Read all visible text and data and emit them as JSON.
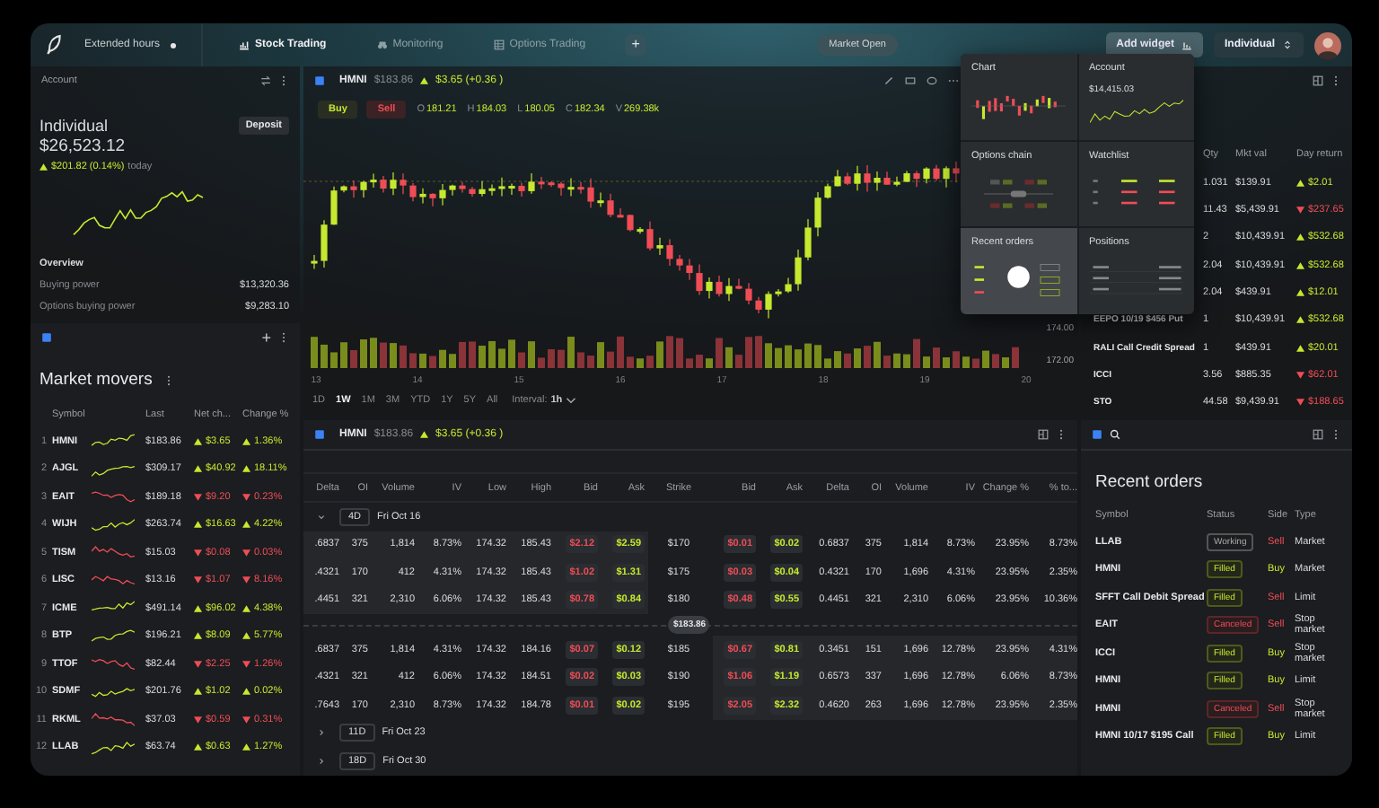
{
  "top_bar": {
    "extended_hours": "Extended hours",
    "tabs": [
      {
        "label": "Stock Trading",
        "kind": "chart",
        "selected": true
      },
      {
        "label": "Monitoring",
        "kind": "binoculars",
        "selected": false
      },
      {
        "label": "Options Trading",
        "kind": "table",
        "selected": false
      }
    ],
    "add_tab": "+",
    "market_status": "Market Open",
    "add_widget": "Add widget",
    "account_selector": "Individual"
  },
  "account": {
    "title": "Account",
    "name": "Individual",
    "deposit": "Deposit",
    "balance": "$26,523.12",
    "up": true,
    "change": "$201.82 (0.14%)",
    "period": "today",
    "overview_title": "Overview",
    "overview": [
      {
        "label": "Buying power",
        "value": "$13,320.36"
      },
      {
        "label": "Options buying power",
        "value": "$9,283.10"
      }
    ]
  },
  "market_movers": {
    "title": "Market movers",
    "add": "+",
    "columns": [
      "Symbol",
      "Last",
      "Net ch...",
      "Change %"
    ],
    "rows": [
      {
        "rank": "1",
        "symbol": "HMNI",
        "last": "$183.86",
        "net_change": "$3.65",
        "change_pct": "1.36%",
        "up": true
      },
      {
        "rank": "2",
        "symbol": "AJGL",
        "last": "$309.17",
        "net_change": "$40.92",
        "change_pct": "18.11%",
        "up": true
      },
      {
        "rank": "3",
        "symbol": "EAIT",
        "last": "$189.18",
        "net_change": "$9.20",
        "change_pct": "0.23%",
        "up": false
      },
      {
        "rank": "4",
        "symbol": "WIJH",
        "last": "$263.74",
        "net_change": "$16.63",
        "change_pct": "4.22%",
        "up": true
      },
      {
        "rank": "5",
        "symbol": "TISM",
        "last": "$15.03",
        "net_change": "$0.08",
        "change_pct": "0.03%",
        "up": false
      },
      {
        "rank": "6",
        "symbol": "LISC",
        "last": "$13.16",
        "net_change": "$1.07",
        "change_pct": "8.16%",
        "up": false
      },
      {
        "rank": "7",
        "symbol": "ICME",
        "last": "$491.14",
        "net_change": "$96.02",
        "change_pct": "4.38%",
        "up": true
      },
      {
        "rank": "8",
        "symbol": "BTP",
        "last": "$196.21",
        "net_change": "$8.09",
        "change_pct": "5.77%",
        "up": true
      },
      {
        "rank": "9",
        "symbol": "TTOF",
        "last": "$82.44",
        "net_change": "$2.25",
        "change_pct": "1.26%",
        "up": false
      },
      {
        "rank": "10",
        "symbol": "SDMF",
        "last": "$201.76",
        "net_change": "$1.02",
        "change_pct": "0.02%",
        "up": true
      },
      {
        "rank": "11",
        "symbol": "RKML",
        "last": "$37.03",
        "net_change": "$0.59",
        "change_pct": "0.31%",
        "up": false
      },
      {
        "rank": "12",
        "symbol": "LLAB",
        "last": "$63.74",
        "net_change": "$0.63",
        "change_pct": "1.27%",
        "up": true
      }
    ]
  },
  "chart": {
    "symbol": "HMNI",
    "price": "$183.86",
    "up": true,
    "change": "$3.65 (+0.36 )",
    "buy": "Buy",
    "sell": "Sell",
    "ohlcv": [
      {
        "label": "O",
        "value": "181.21"
      },
      {
        "label": "H",
        "value": "184.03"
      },
      {
        "label": "L",
        "value": "180.05"
      },
      {
        "label": "C",
        "value": "182.34"
      },
      {
        "label": "V",
        "value": "269.38k"
      }
    ],
    "price_labels": [
      "174.00",
      "172.00"
    ],
    "x_labels": [
      "13",
      "14",
      "15",
      "16",
      "17",
      "18",
      "19",
      "20"
    ],
    "ranges": [
      {
        "label": "1D",
        "selected": false
      },
      {
        "label": "1W",
        "selected": true
      },
      {
        "label": "1M",
        "selected": false
      },
      {
        "label": "3M",
        "selected": false
      },
      {
        "label": "YTD",
        "selected": false
      },
      {
        "label": "1Y",
        "selected": false
      },
      {
        "label": "5Y",
        "selected": false
      },
      {
        "label": "All",
        "selected": false
      }
    ],
    "interval_label": "Interval:",
    "interval": "1h"
  },
  "options_chain": {
    "symbol": "HMNI",
    "price": "$183.86",
    "up": true,
    "change": "$3.65 (+0.36 )",
    "call_columns": [
      "Delta",
      "OI",
      "Volume",
      "IV",
      "Low",
      "High",
      "Bid",
      "Ask"
    ],
    "strike_column": "Strike",
    "put_columns": [
      "Bid",
      "Ask",
      "Delta",
      "OI",
      "Volume",
      "IV",
      "Change %",
      "% to..."
    ],
    "expirations": [
      {
        "days": "4D",
        "date": "Fri Oct 16",
        "expanded": true,
        "rows": [
          {
            "kind": "strike",
            "calls": [
              ".6837",
              "375",
              "1,814",
              "8.73%",
              "174.32",
              "185.43",
              "$2.12",
              "$2.59"
            ],
            "calls_itm": true,
            "strike": "$170",
            "puts": [
              "$0.01",
              "$0.02",
              "0.6837",
              "375",
              "1,814",
              "8.73%",
              "23.95%",
              "8.73%"
            ],
            "puts_itm": false
          },
          {
            "kind": "strike",
            "calls": [
              ".4321",
              "170",
              "412",
              "4.31%",
              "174.32",
              "185.43",
              "$1.02",
              "$1.31"
            ],
            "calls_itm": true,
            "strike": "$175",
            "puts": [
              "$0.03",
              "$0.04",
              "0.4321",
              "170",
              "1,696",
              "4.31%",
              "23.95%",
              "2.35%"
            ],
            "puts_itm": false
          },
          {
            "kind": "strike",
            "calls": [
              ".4451",
              "321",
              "2,310",
              "6.06%",
              "174.32",
              "185.43",
              "$0.78",
              "$0.84"
            ],
            "calls_itm": true,
            "strike": "$180",
            "puts": [
              "$0.48",
              "$0.55",
              "0.4451",
              "321",
              "2,310",
              "6.06%",
              "23.95%",
              "10.36%"
            ],
            "puts_itm": false
          },
          {
            "kind": "marker",
            "price": "$183.86"
          },
          {
            "kind": "strike",
            "calls": [
              ".6837",
              "375",
              "1,814",
              "4.31%",
              "174.32",
              "184.16",
              "$0.07",
              "$0.12"
            ],
            "calls_itm": false,
            "strike": "$185",
            "puts": [
              "$0.67",
              "$0.81",
              "0.3451",
              "151",
              "1,696",
              "12.78%",
              "23.95%",
              "4.31%"
            ],
            "puts_itm": true
          },
          {
            "kind": "strike",
            "calls": [
              ".4321",
              "321",
              "412",
              "6.06%",
              "174.32",
              "184.51",
              "$0.02",
              "$0.03"
            ],
            "calls_itm": false,
            "strike": "$190",
            "puts": [
              "$1.06",
              "$1.19",
              "0.6573",
              "337",
              "1,696",
              "12.78%",
              "6.06%",
              "8.73%"
            ],
            "puts_itm": true
          },
          {
            "kind": "strike",
            "calls": [
              ".7643",
              "170",
              "2,310",
              "8.73%",
              "174.32",
              "184.78",
              "$0.01",
              "$0.02"
            ],
            "calls_itm": false,
            "strike": "$195",
            "puts": [
              "$2.05",
              "$2.32",
              "0.4620",
              "263",
              "1,696",
              "12.78%",
              "23.95%",
              "2.35%"
            ],
            "puts_itm": true
          }
        ]
      },
      {
        "days": "11D",
        "date": "Fri Oct 23",
        "expanded": false
      },
      {
        "days": "18D",
        "date": "Fri Oct 30",
        "expanded": false
      }
    ]
  },
  "positions": {
    "columns": [
      "Qty",
      "Mkt val",
      "Day return"
    ],
    "rows": [
      {
        "qty": "1.031",
        "market_value": "$139.91",
        "day_return": "$2.01",
        "up": true
      },
      {
        "qty": "11.43",
        "market_value": "$5,439.91",
        "day_return": "$237.65",
        "up": false
      },
      {
        "qty": "2",
        "market_value": "$10,439.91",
        "day_return": "$532.68",
        "up": true
      },
      {
        "qty": "2.04",
        "market_value": "$10,439.91",
        "day_return": "$532.68",
        "up": true
      },
      {
        "qty": "2.04",
        "market_value": "$439.91",
        "day_return": "$12.01",
        "up": true
      },
      {
        "symbol": "EEPO 10/19 $456 Put",
        "qty": "1",
        "market_value": "$10,439.91",
        "day_return": "$532.68",
        "up": true
      },
      {
        "symbol": "RALI Call Credit Spread",
        "qty": "1",
        "market_value": "$439.91",
        "day_return": "$20.01",
        "up": true
      },
      {
        "symbol": "ICCI",
        "qty": "3.56",
        "market_value": "$885.35",
        "day_return": "$62.01",
        "up": false
      },
      {
        "symbol": "STO",
        "qty": "44.58",
        "market_value": "$9,439.91",
        "day_return": "$188.65",
        "up": false
      }
    ]
  },
  "recent_orders": {
    "title": "Recent orders",
    "columns": [
      "Symbol",
      "Status",
      "Side",
      "Type"
    ],
    "rows": [
      {
        "symbol": "LLAB",
        "status": "Working",
        "kind": "working",
        "side": "Sell",
        "buy": false,
        "type": "Market"
      },
      {
        "symbol": "HMNI",
        "status": "Filled",
        "kind": "filled",
        "side": "Buy",
        "buy": true,
        "type": "Market"
      },
      {
        "symbol": "SFFT Call Debit Spread",
        "status": "Filled",
        "kind": "filled",
        "side": "Sell",
        "buy": false,
        "type": "Limit"
      },
      {
        "symbol": "EAIT",
        "status": "Canceled",
        "kind": "canceled",
        "side": "Sell",
        "buy": false,
        "type": "Stop market"
      },
      {
        "symbol": "ICCI",
        "status": "Filled",
        "kind": "filled",
        "side": "Buy",
        "buy": true,
        "type": "Stop market"
      },
      {
        "symbol": "HMNI",
        "status": "Filled",
        "kind": "filled",
        "side": "Buy",
        "buy": true,
        "type": "Limit"
      },
      {
        "symbol": "HMNI",
        "status": "Canceled",
        "kind": "canceled",
        "side": "Sell",
        "buy": false,
        "type": "Stop market"
      },
      {
        "symbol": "HMNI 10/17 $195 Call",
        "status": "Filled",
        "kind": "filled",
        "side": "Buy",
        "buy": true,
        "type": "Limit"
      }
    ]
  },
  "widget_picker": {
    "tiles": [
      {
        "title": "Chart",
        "kind": "chart",
        "selected": false
      },
      {
        "title": "Account",
        "kind": "account",
        "value": "$14,415.03",
        "selected": false
      },
      {
        "title": "Options chain",
        "kind": "options",
        "selected": false
      },
      {
        "title": "Watchlist",
        "kind": "watchlist",
        "selected": false
      },
      {
        "title": "Recent orders",
        "kind": "orders",
        "selected": true
      },
      {
        "title": "Positions",
        "kind": "positions",
        "selected": false
      }
    ]
  }
}
